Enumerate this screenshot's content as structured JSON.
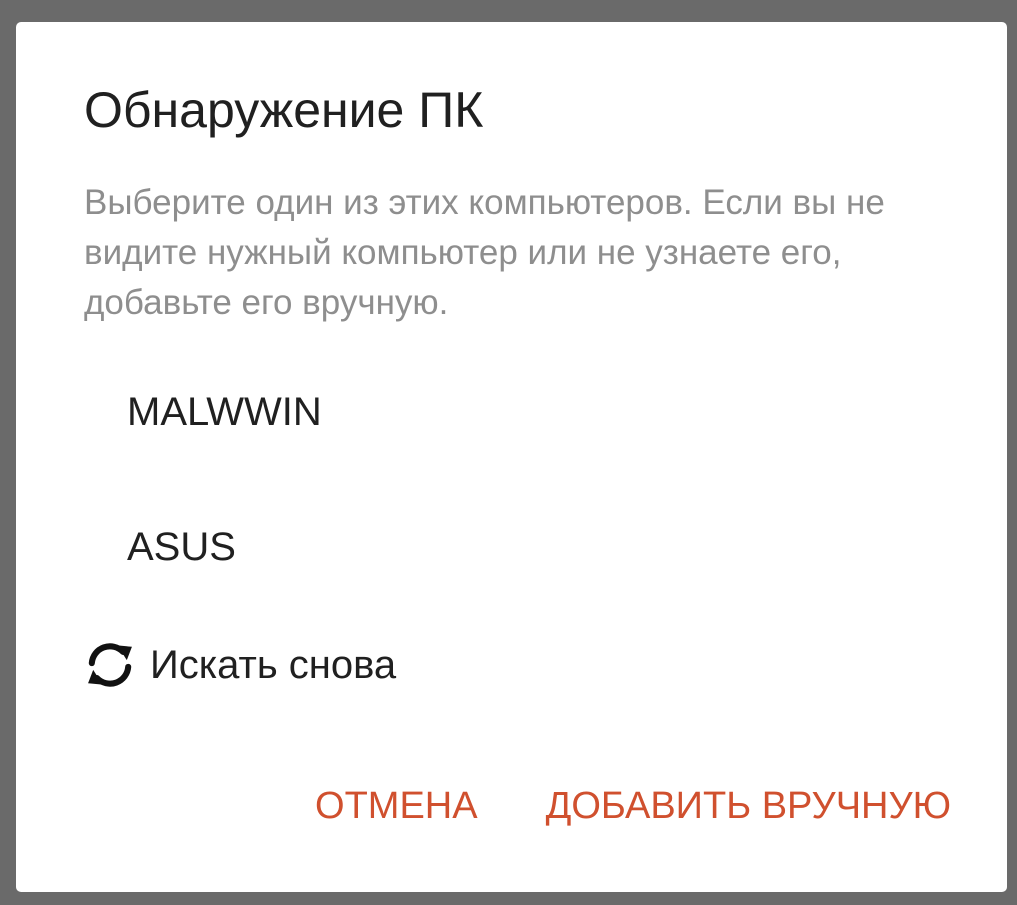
{
  "dialog": {
    "title": "Обнаружение ПК",
    "message": "Выберите один из этих компьютеров. Если вы не видите нужный компьютер или не узнаете его, добавьте его вручную.",
    "computers": [
      {
        "name": "MALWWIN"
      },
      {
        "name": "ASUS"
      }
    ],
    "refresh": {
      "icon": "refresh-icon",
      "label": "Искать снова"
    },
    "actions": {
      "cancel_label": "ОТМЕНА",
      "add_manually_label": "ДОБАВИТЬ ВРУЧНУЮ"
    },
    "colors": {
      "accent": "#d0502e",
      "text": "#202020",
      "secondary_text": "#8e8e8e",
      "scrim": "#6a6a6a"
    }
  }
}
